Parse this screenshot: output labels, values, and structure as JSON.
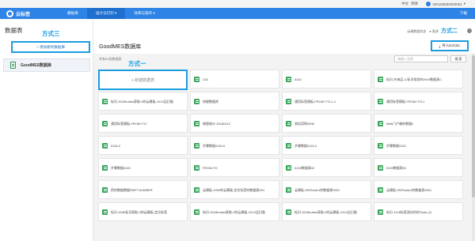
{
  "topbar": {
    "lang_label": "中文",
    "lang_alt": "简体",
    "user_id": "330159000000001"
  },
  "nav": {
    "brand": "云标签",
    "items": [
      {
        "label": "模板库",
        "active": false
      },
      {
        "label": "设计与打印 ▾",
        "active": true
      },
      {
        "label": "效率与操作 ▾",
        "active": false
      }
    ],
    "download_label": "下载"
  },
  "sidebar": {
    "title": "数据表",
    "add_label": "+ 添加新的数据库",
    "annotation": "方式三",
    "db_item": "GoodMES数据库"
  },
  "main": {
    "title": "GoodMES数据库",
    "toggle_label": "云端数据状态",
    "toggle_opt1": "● 离线",
    "toggle_opt2": "本 下载 开放",
    "annotation2": "方式二",
    "import_label": "导入EXCEL",
    "count_label": "共有50张数据表",
    "search_placeholder": "请输入名称",
    "search_button": "搜 索",
    "annotation1": "方式一",
    "new_table_label": "+ 新建数据表",
    "tables": [
      "234",
      "0116",
      "标识-外来品-4-标识领发的0919数据表C",
      "标识-2018hulian获取-0的云模板-1013品扫描",
      "快捷数据库",
      "通用标签模板-FROM+TO-1-1",
      "通用标签模板-FROM+TO-1",
      "通用标签模板-FROM+TO",
      "制版统计-20180112",
      "测试用例0906",
      "Web门户端的数据0",
      "0116-2",
      "步骤数据0115-0",
      "步骤数据0115-2",
      "步骤数据0115",
      "步骤数据0115",
      "FROM-TO",
      "0109数据表02",
      "0109数据表01",
      "药剂数据数据PART NUMBER",
      "云模板-1900的云模板-定位标签的数据表001",
      "云模板-092Sostc1的数据表0921",
      "云模板-092Sostc1的数据表0001",
      "标识-0036标识获取-0的云模板-定位标签",
      "标识-2018hulian获取-0的云模板-1013品扫描",
      "标识-2018hulian获取-0的云模板-1013品扫描",
      "标识-1126标签测试的的Tools (1)"
    ]
  },
  "colors": {
    "nav_bg": "#2e84e6",
    "annotation": "#1a9de0",
    "tile_icon": "#3aa55d"
  }
}
